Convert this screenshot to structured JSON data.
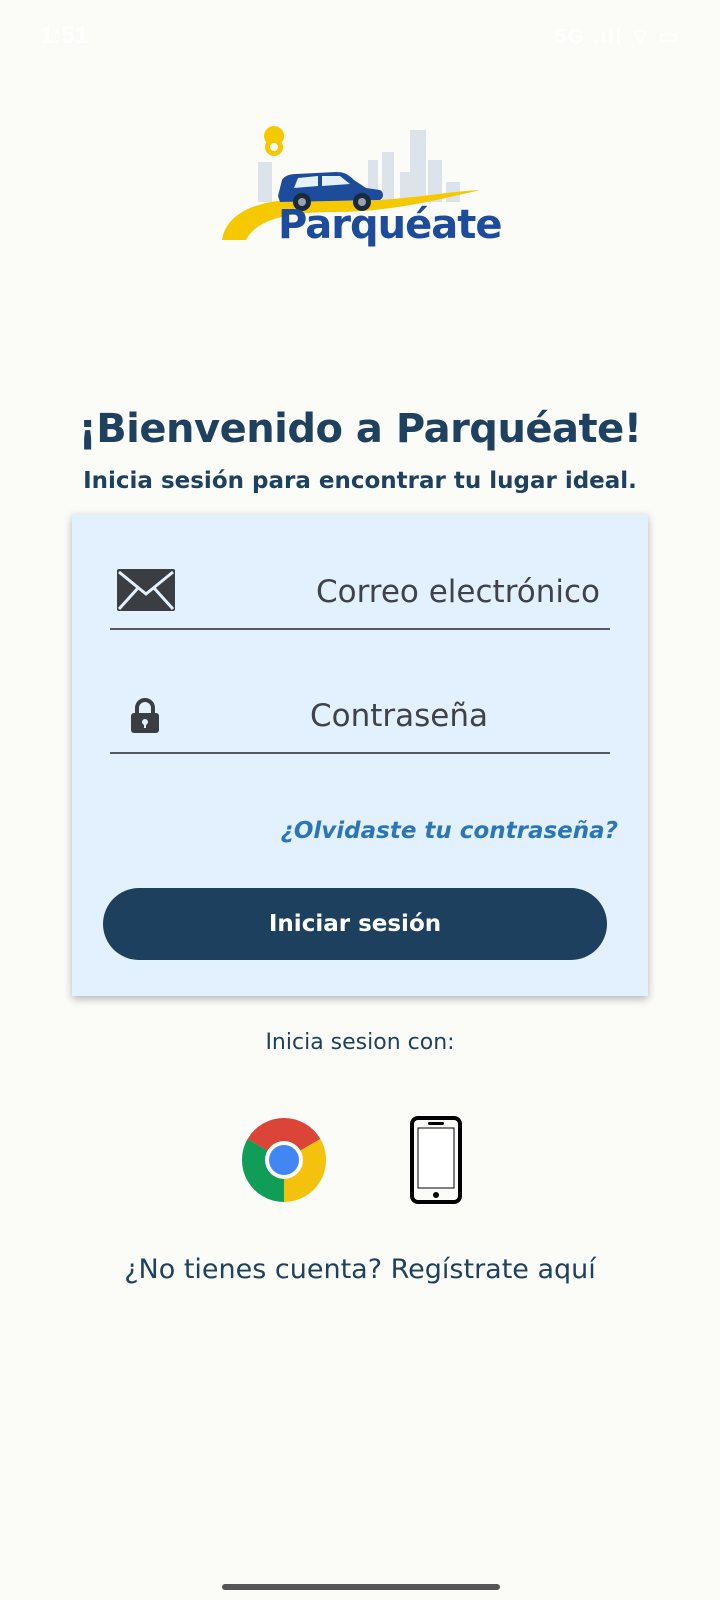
{
  "status_bar": {
    "time": "1:51",
    "icons_text": "5G  .ıll  ⌔  ▭"
  },
  "brand": {
    "name": "Parquéate",
    "icon_names": [
      "pin-icon",
      "car-icon",
      "city-skyline-icon",
      "road-swoosh-icon"
    ]
  },
  "header": {
    "title": "¡Bienvenido a Parquéate!",
    "subtitle": "Inicia sesión para encontrar tu lugar ideal."
  },
  "login_form": {
    "email_placeholder": "Correo electrónico",
    "email_icon": "envelope-icon",
    "password_placeholder": "Contraseña",
    "password_icon": "lock-icon",
    "forgot_password": "¿Olvidaste tu contraseña?",
    "submit_label": "Iniciar sesión"
  },
  "alt_login": {
    "label": "Inicia sesion con:",
    "options": [
      "chrome-icon",
      "phone-icon"
    ]
  },
  "footer": {
    "register_text": "¿No tienes cuenta? Regístrate aquí"
  },
  "colors": {
    "background": "#fbfbf8",
    "primary_dark": "#1d405e",
    "card_bg": "#e3f0fd",
    "link_blue": "#2a76b8",
    "brand_blue": "#1d4c9c",
    "brand_yellow": "#f5c800"
  }
}
